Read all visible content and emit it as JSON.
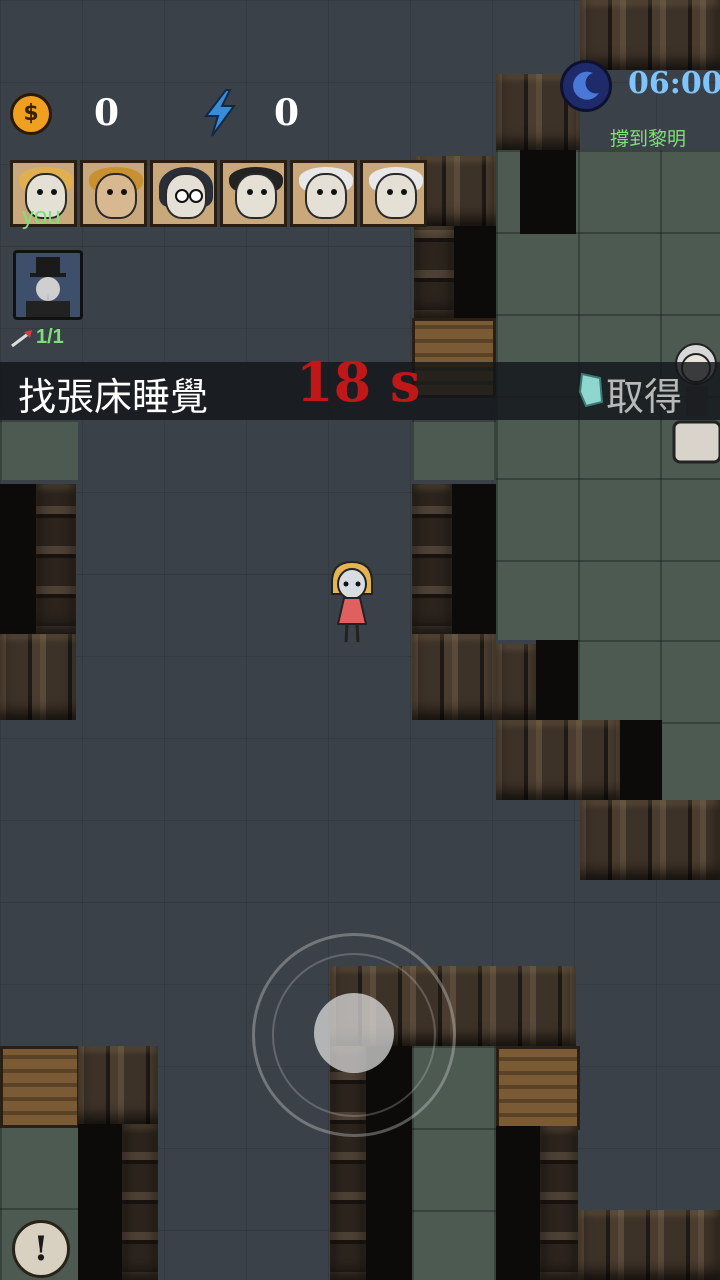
{
  "hud": {
    "coins": "0",
    "energy": "0",
    "time": "06:00",
    "objective_hint": "撐到黎明",
    "you_label": "you",
    "ammo": "1/1"
  },
  "task": {
    "text": "找張床睡覺",
    "countdown": "18 s",
    "action_label": "取得"
  },
  "icons": {
    "coin": "coin-icon",
    "energy": "lightning-bolt-icon",
    "night": "moon-clock-icon",
    "item": "plague-doctor-card-icon",
    "ammo": "arrow-icon",
    "reward": "crystal-gem-icon",
    "alert": "exclamation-icon"
  },
  "coin_symbol": "$",
  "alert_symbol": "!",
  "players": [
    {
      "name": "player-1-you",
      "hair": "#e0b050"
    },
    {
      "name": "player-2-miner",
      "hair": "#c89030"
    },
    {
      "name": "player-3-hooded",
      "hair": "#2a2e38"
    },
    {
      "name": "player-4-dark-hair",
      "hair": "#222222"
    },
    {
      "name": "player-5-white-hair",
      "hair": "#e8e8e8"
    },
    {
      "name": "player-6-white-hair",
      "hair": "#e8e8e8"
    }
  ],
  "colors": {
    "timer": "#c01818",
    "time": "#7ec4ff",
    "hint": "#7fe07a"
  }
}
